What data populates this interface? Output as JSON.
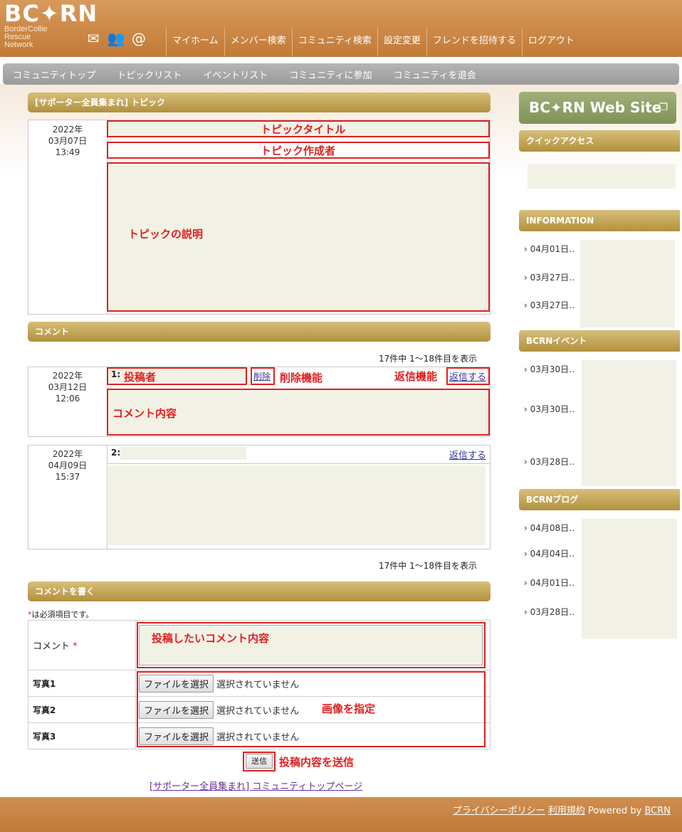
{
  "header": {
    "logo_text": "BC✦RN",
    "logo_sub": [
      "BorderCollie",
      "Rescue",
      "Network"
    ],
    "icons": [
      "mail-icon",
      "people-icon",
      "at-icon"
    ],
    "nav": [
      "マイホーム",
      "メンバー検索",
      "コミュニティ検索",
      "設定変更",
      "フレンドを招待する",
      "ログアウト"
    ]
  },
  "subnav": [
    "コミュニティトップ",
    "トピックリスト",
    "イベントリスト",
    "コミュニティに参加",
    "コミュニティを退会"
  ],
  "topic": {
    "section_title": "[サポーター全員集まれ] トピック",
    "date": "2022年",
    "date2": "03月07日",
    "time": "13:49",
    "title_label": "トピックタイトル",
    "author_label": "トピック作成者",
    "desc_label": "トピックの説明"
  },
  "comments": {
    "section_title": "コメント",
    "count_text": "17件中 1〜18件目を表示",
    "items": [
      {
        "date": "2022年",
        "date2": "03月12日",
        "time": "12:06",
        "num": "1:",
        "author_label": "投稿者",
        "delete": "削除",
        "delete_label": "削除機能",
        "reply_label": "返信機能",
        "reply": "返信する",
        "content_label": "コメント内容"
      },
      {
        "date": "2022年",
        "date2": "04月09日",
        "time": "15:37",
        "num": "2:",
        "reply": "返信する"
      }
    ]
  },
  "form": {
    "section_title": "コメントを書く",
    "required_mark": "*",
    "required_note": "は必須項目です。",
    "comment_label": "コメント",
    "comment_annotation": "投稿したいコメント内容",
    "photo_labels": [
      "写真1",
      "写真2",
      "写真3"
    ],
    "file_button": "ファイルを選択",
    "no_file": "選択されていません",
    "image_annotation": "画像を指定",
    "submit": "送信",
    "submit_annotation": "投稿内容を送信",
    "back_link": "[サポーター全員集まれ] コミュニティトップページ"
  },
  "sidebar": {
    "website_banner": "BC✦RN  Web Site",
    "quick_access": "クイックアクセス",
    "information": "INFORMATION",
    "info_items": [
      "› 04月01日‥",
      "› 03月27日‥",
      "› 03月27日‥"
    ],
    "events": "BCRNイベント",
    "event_items": [
      "› 03月30日‥",
      "› 03月30日‥",
      "› 03月28日‥"
    ],
    "blog": "BCRNブログ",
    "blog_items": [
      "› 04月08日‥",
      "› 04月04日‥",
      "› 04月01日‥",
      "› 03月28日‥"
    ]
  },
  "footer": {
    "privacy": "プライバシーポリシー",
    "terms": "利用規約",
    "powered": "Powered by",
    "brand": "BCRN"
  }
}
